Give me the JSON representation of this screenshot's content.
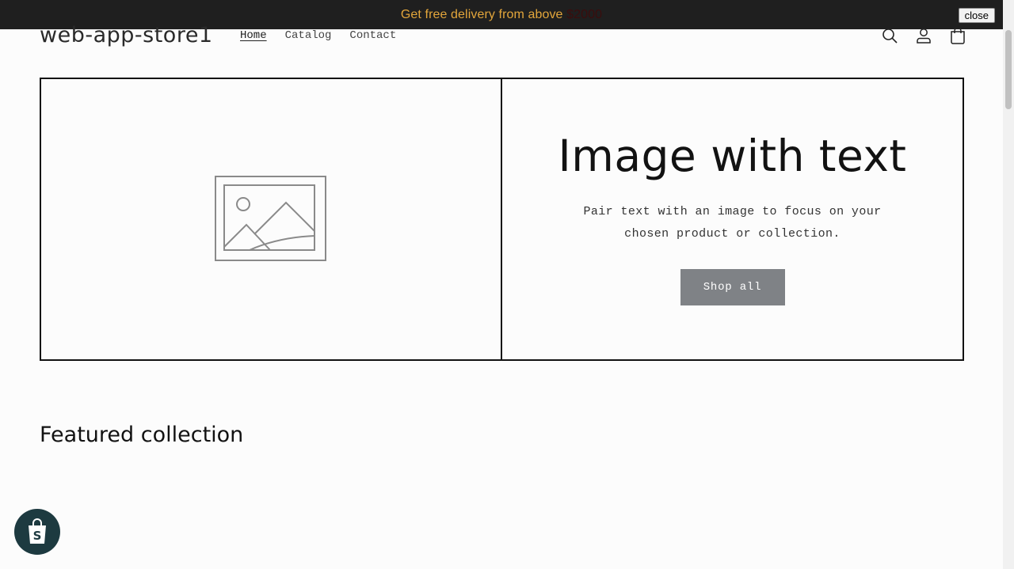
{
  "banner": {
    "text": "Get free delivery from above ",
    "amount": "$2000",
    "close_label": "close"
  },
  "header": {
    "logo": "web-app-store1",
    "nav": [
      {
        "label": "Home",
        "active": true
      },
      {
        "label": "Catalog",
        "active": false
      },
      {
        "label": "Contact",
        "active": false
      }
    ],
    "icons": [
      "search-icon",
      "account-icon",
      "cart-icon"
    ]
  },
  "hero": {
    "title": "Image with text",
    "description": "Pair text with an image to focus on your chosen product or collection.",
    "button_label": "Shop all"
  },
  "featured": {
    "title": "Featured collection"
  },
  "colors": {
    "banner_bg": "#1f1f1f",
    "banner_text": "#e3a63b",
    "button_bg": "#7f8286",
    "badge_bg": "#1d3a40"
  }
}
